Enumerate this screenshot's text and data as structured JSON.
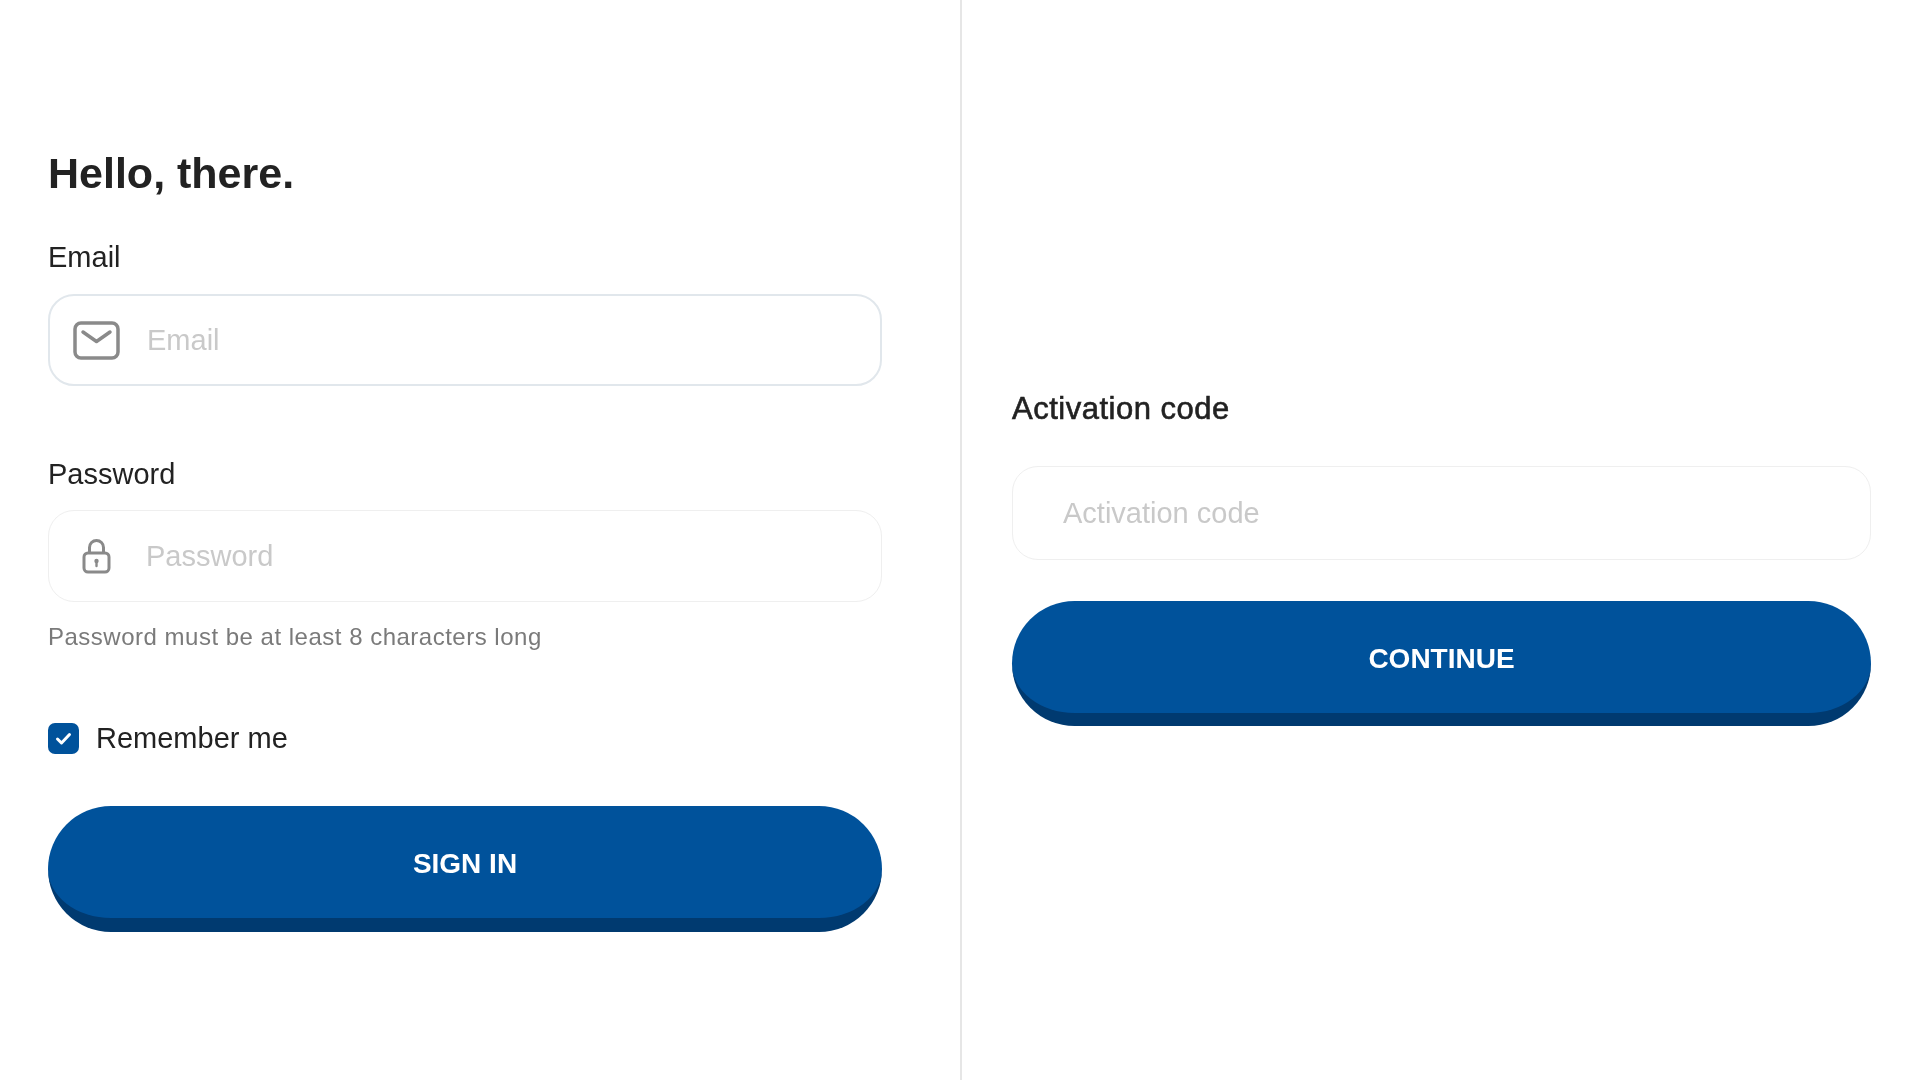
{
  "sign_in": {
    "heading": "Hello, there.",
    "email": {
      "label": "Email",
      "placeholder": "Email",
      "focused": true
    },
    "password": {
      "label": "Password",
      "placeholder": "Password",
      "focused": false,
      "hint": "Password must be at least 8 characters long"
    },
    "remember_me": {
      "label": "Remember me",
      "checked": true
    },
    "button": "SIGN IN"
  },
  "activation": {
    "label": "Activation code",
    "field": {
      "placeholder": "Activation code",
      "focused": false
    },
    "button": "CONTINUE"
  }
}
